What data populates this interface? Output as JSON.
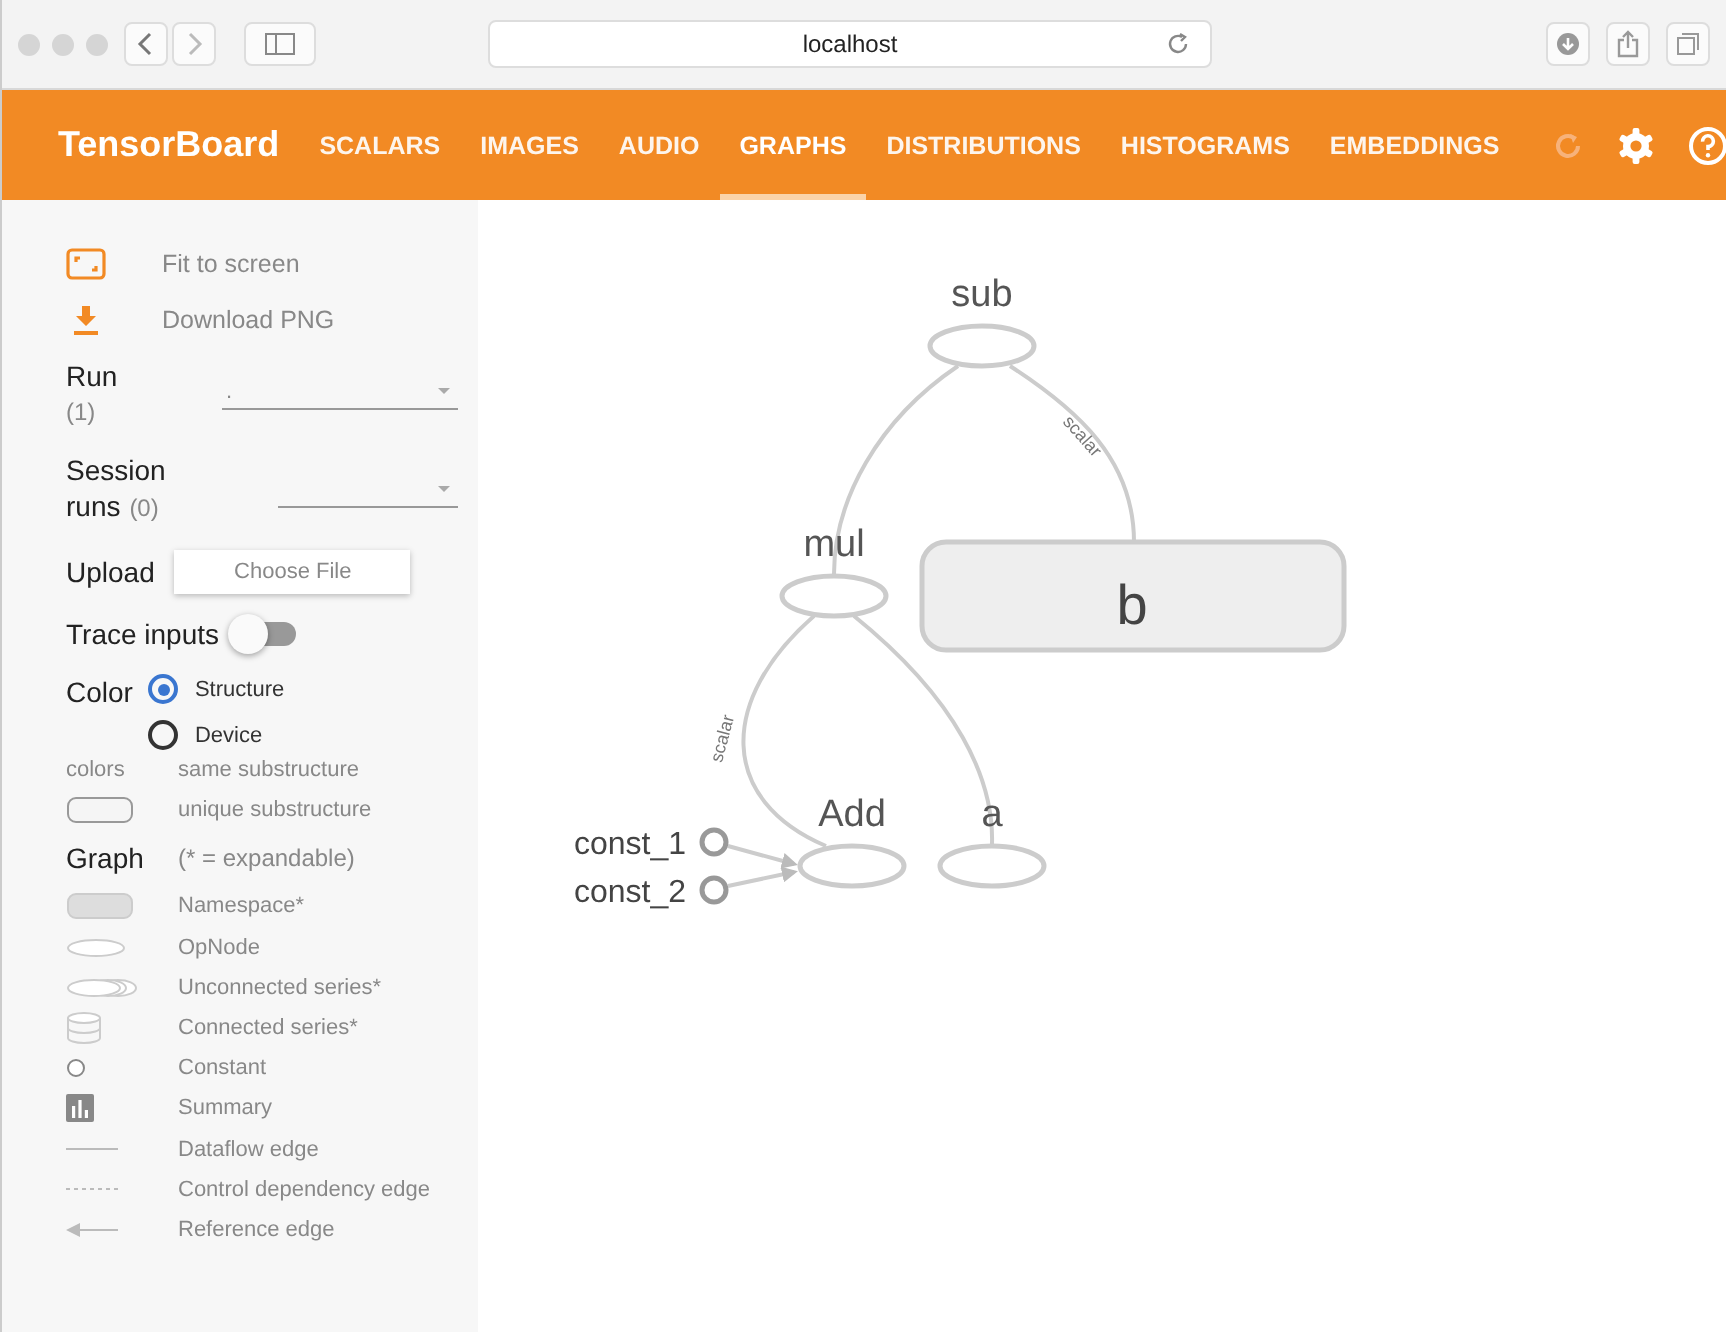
{
  "browser": {
    "address": "localhost"
  },
  "app": {
    "title": "TensorBoard"
  },
  "tabs": [
    {
      "label": "SCALARS",
      "selected": false
    },
    {
      "label": "IMAGES",
      "selected": false
    },
    {
      "label": "AUDIO",
      "selected": false
    },
    {
      "label": "GRAPHS",
      "selected": true
    },
    {
      "label": "DISTRIBUTIONS",
      "selected": false
    },
    {
      "label": "HISTOGRAMS",
      "selected": false
    },
    {
      "label": "EMBEDDINGS",
      "selected": false
    }
  ],
  "sidebar": {
    "actions": [
      {
        "kind": "fit",
        "label": "Fit to screen"
      },
      {
        "kind": "download",
        "label": "Download PNG"
      }
    ],
    "run": {
      "label": "Run",
      "count": "(1)",
      "value": "."
    },
    "session_runs": {
      "label": "Session",
      "label_2": "runs",
      "count": "(0)"
    },
    "upload": {
      "label": "Upload",
      "button": "Choose File"
    },
    "trace_inputs": {
      "label": "Trace inputs",
      "on": false
    },
    "color": {
      "label": "Color",
      "options": [
        {
          "label": "Structure",
          "selected": true
        },
        {
          "label": "Device",
          "selected": false
        }
      ]
    },
    "color_legend": [
      {
        "kind": "text",
        "symbol": "colors",
        "label": "same substructure"
      },
      {
        "kind": "unique",
        "label": "unique substructure"
      }
    ],
    "graph_legend": {
      "label": "Graph",
      "note": "(* = expandable)",
      "items": [
        {
          "kind": "namespace",
          "label": "Namespace*"
        },
        {
          "kind": "opnode",
          "label": "OpNode"
        },
        {
          "kind": "unconnected",
          "label": "Unconnected series*"
        },
        {
          "kind": "connected",
          "label": "Connected series*"
        },
        {
          "kind": "constant",
          "label": "Constant"
        },
        {
          "kind": "summary",
          "label": "Summary"
        },
        {
          "kind": "dataflow",
          "label": "Dataflow edge"
        },
        {
          "kind": "control",
          "label": "Control dependency edge"
        },
        {
          "kind": "reference",
          "label": "Reference edge"
        }
      ]
    }
  },
  "graph": {
    "nodes": [
      {
        "kind": "op",
        "label": "sub"
      },
      {
        "kind": "op",
        "label": "mul"
      },
      {
        "kind": "namespace",
        "label": "b"
      },
      {
        "kind": "op",
        "label": "Add"
      },
      {
        "kind": "op",
        "label": "a"
      },
      {
        "kind": "constant",
        "label": "const_1"
      },
      {
        "kind": "constant",
        "label": "const_2"
      }
    ],
    "edges": [
      {
        "arrow": false
      },
      {
        "label": "scalar",
        "arrow": false
      },
      {
        "label": "scalar",
        "arrow": false
      },
      {
        "arrow": false
      },
      {
        "arrow": true
      },
      {
        "arrow": true
      }
    ]
  }
}
